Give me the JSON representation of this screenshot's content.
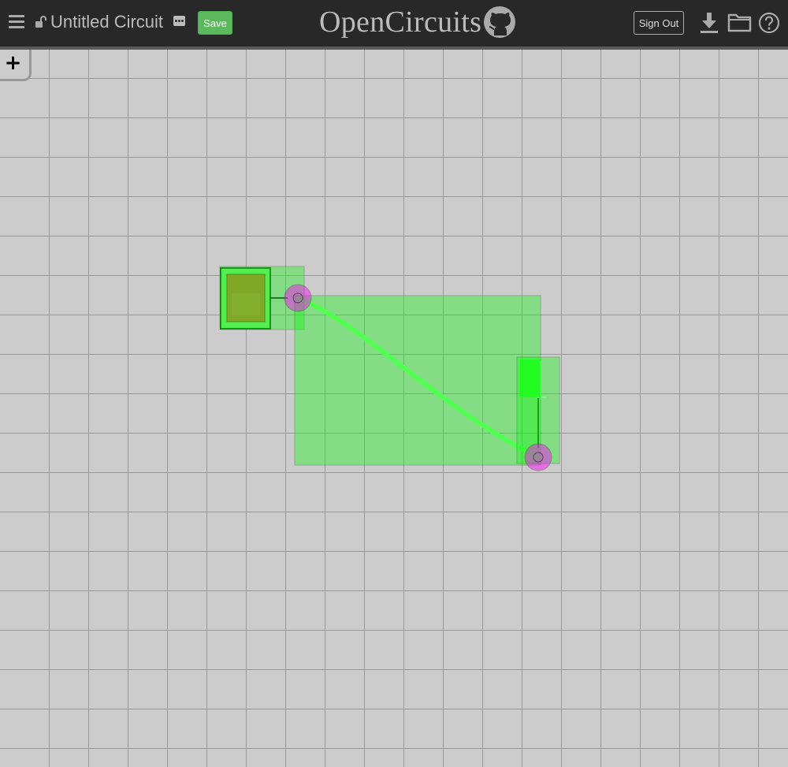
{
  "header": {
    "title_value": "Untitled Circuit",
    "save_label": "Save",
    "logo_text": "OpenCircuits",
    "sign_out_label": "Sign Out"
  },
  "icons": {
    "menu": "hamburger-menu-icon",
    "lock": "unlock-icon",
    "more": "more-dots-icon",
    "github": "github-icon",
    "download": "download-icon",
    "open": "folder-icon",
    "help": "help-icon",
    "add": "plus-icon"
  },
  "toolbar": {
    "add_label": "+"
  },
  "colors": {
    "header_bg": "#282828",
    "canvas_bg": "#cccccc",
    "grid_line": "#999999",
    "save_bg": "#5cb85c",
    "selection_fill": "#00ff00",
    "port_fill": "#ff00ff",
    "switch_fill": "#c8783c",
    "wire_on": "#7cff7c"
  }
}
